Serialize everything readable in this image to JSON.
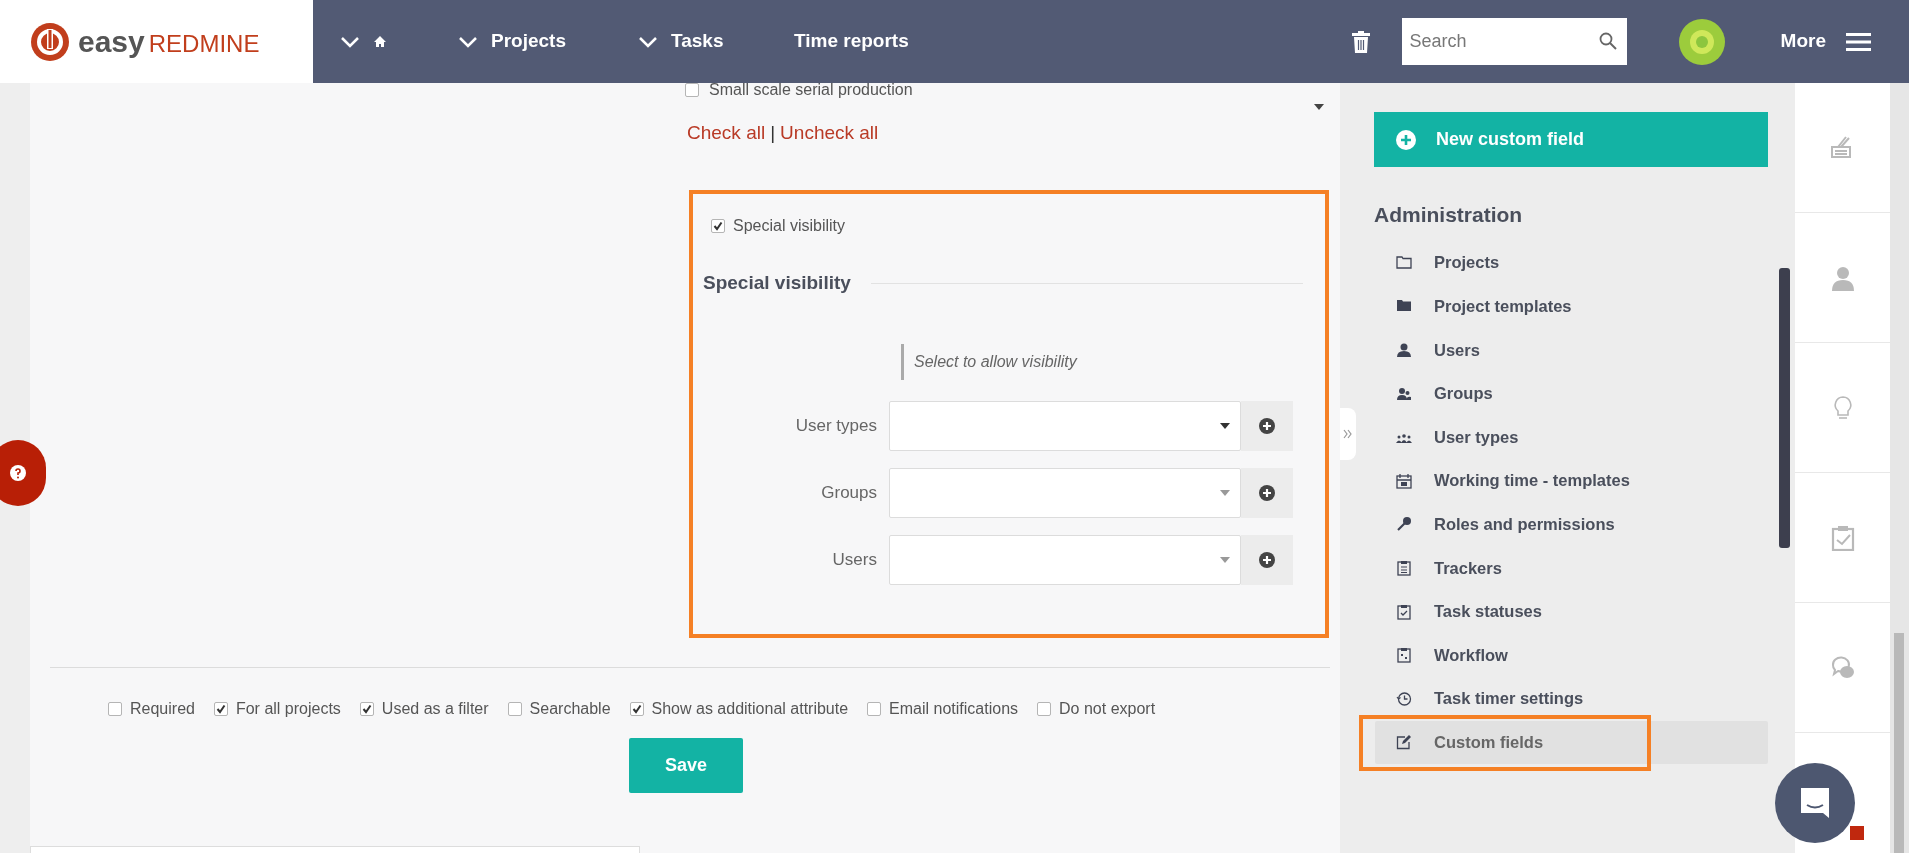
{
  "header": {
    "logo": {
      "word_1": "easy",
      "word_2": "REDMINE"
    },
    "nav": [
      {
        "kind": "home",
        "dropdown": true
      },
      {
        "kind": "text",
        "label": "Projects",
        "dropdown": true
      },
      {
        "kind": "text",
        "label": "Tasks",
        "dropdown": true
      },
      {
        "kind": "text",
        "label": "Time reports",
        "dropdown": false
      }
    ],
    "search": {
      "placeholder": "Search"
    },
    "more": "More"
  },
  "form": {
    "project_list": {
      "items": [
        {
          "label": "Small scale serial production",
          "checked": false
        }
      ],
      "check_all": "Check all",
      "separator": "|",
      "uncheck_all": "Uncheck all"
    },
    "special_visibility": {
      "highlighted": true,
      "checkbox": {
        "label": "Special visibility",
        "checked": true
      },
      "heading": "Special visibility",
      "hint": "Select to allow visibility",
      "fields": [
        {
          "label": "User types"
        },
        {
          "label": "Groups"
        },
        {
          "label": "Users"
        }
      ]
    },
    "options": [
      {
        "label": "Required",
        "checked": false
      },
      {
        "label": "For all projects",
        "checked": true
      },
      {
        "label": "Used as a filter",
        "checked": true
      },
      {
        "label": "Searchable",
        "checked": false
      },
      {
        "label": "Show as additional attribute",
        "checked": true
      },
      {
        "label": "Email notifications",
        "checked": false
      },
      {
        "label": "Do not export",
        "checked": false
      }
    ],
    "save": "Save"
  },
  "sidebar": {
    "new_button": "New custom field",
    "heading": "Administration",
    "items": [
      {
        "label": "Projects",
        "kind": "folder",
        "selected": false,
        "highlighted": false
      },
      {
        "label": "Project templates",
        "kind": "folder-filled",
        "selected": false,
        "highlighted": false
      },
      {
        "label": "Users",
        "kind": "user",
        "selected": false,
        "highlighted": false
      },
      {
        "label": "Groups",
        "kind": "users",
        "selected": false,
        "highlighted": false
      },
      {
        "label": "User types",
        "kind": "people",
        "selected": false,
        "highlighted": false
      },
      {
        "label": "Working time - templates",
        "kind": "calendar",
        "selected": false,
        "highlighted": false
      },
      {
        "label": "Roles and permissions",
        "kind": "key",
        "selected": false,
        "highlighted": false
      },
      {
        "label": "Trackers",
        "kind": "clipboard",
        "selected": false,
        "highlighted": false
      },
      {
        "label": "Task statuses",
        "kind": "clipboard-check",
        "selected": false,
        "highlighted": false
      },
      {
        "label": "Workflow",
        "kind": "workflow",
        "selected": false,
        "highlighted": false
      },
      {
        "label": "Task timer settings",
        "kind": "clock",
        "selected": false,
        "highlighted": false
      },
      {
        "label": "Custom fields",
        "kind": "edit",
        "selected": true,
        "highlighted": true
      }
    ]
  },
  "right_rail": [
    {
      "kind": "stack"
    },
    {
      "kind": "user"
    },
    {
      "kind": "bulb"
    },
    {
      "kind": "clipboard-check"
    },
    {
      "kind": "chat"
    }
  ]
}
